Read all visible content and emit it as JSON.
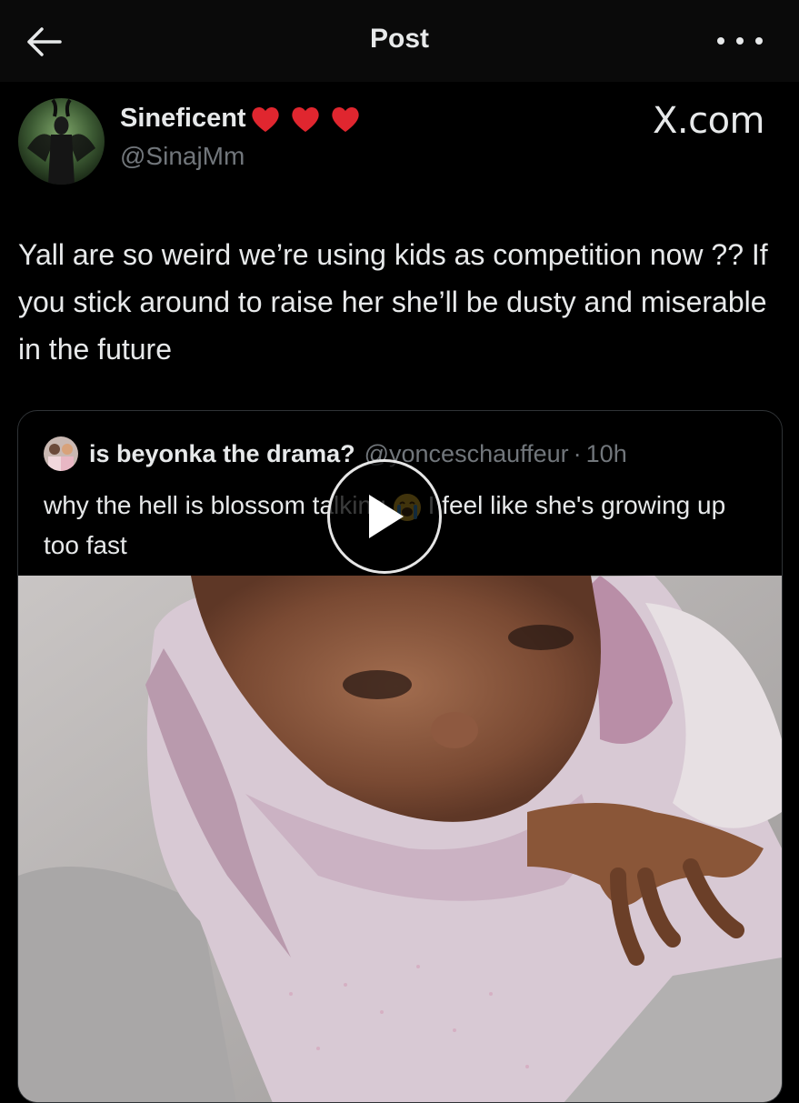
{
  "header": {
    "title": "Post",
    "back_icon": "arrow-left-icon",
    "more_icon": "more-horizontal-icon"
  },
  "post": {
    "display_name": "Sineficent",
    "name_emojis": [
      "red-heart",
      "red-heart",
      "red-heart"
    ],
    "handle": "@SinajMm",
    "watermark": "X.com",
    "text": "Yall are so weird we’re using kids as competition now ?? If you stick around to raise her she’ll be dusty and miserable in the future"
  },
  "quoted": {
    "display_name": "is beyonka the drama?",
    "handle": "@yonceschauffeur",
    "separator": "·",
    "time": "10h",
    "text_before_emoji": "why the hell is blossom talking",
    "emoji": "loudly-crying-face",
    "text_after_emoji": "I feel like she's growing up too fast",
    "media_type": "video",
    "play_icon": "play-icon"
  },
  "colors": {
    "background": "#000000",
    "topbar": "#0a0a0a",
    "text_primary": "#e7e9ea",
    "text_secondary": "#71767b",
    "border": "#2f3336",
    "heart": "#e0262f"
  }
}
